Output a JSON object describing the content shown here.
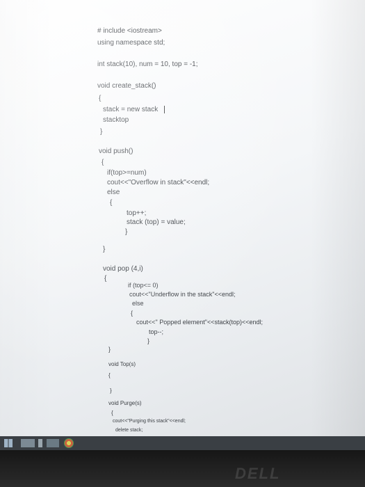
{
  "code": {
    "lines": [
      "# include <iostream>",
      "using namespace std;",
      "int stack(10), num = 10, top = -1;",
      "void create_stack()",
      "{",
      "stack = new stack",
      "stacktop",
      "}",
      "void push()",
      "{",
      "if(top>=num)",
      "cout<<\"Overflow in stack\"<<endl;",
      "else",
      "{",
      "top++;",
      "stack (top) = value;",
      "}",
      "}",
      "void pop (4,i)",
      "{",
      "if (top<= 0)",
      "cout<<\"Underflow in the stack\"<<endl;",
      "else",
      "{",
      "cout<<\" Popped element\"<<stack(top)<<endl;",
      "top--;",
      "}",
      "}",
      "void Top(s)",
      "{",
      "}",
      "void Purge(s)",
      "{",
      "cout<<\"Purging this stack\"<<endl;",
      "delete stack;"
    ]
  },
  "taskbar": {
    "icons": [
      "start-icon",
      "file-explorer-icon",
      "app-icon",
      "app-icon-2",
      "app-icon-3"
    ]
  },
  "colors": {
    "text": "#3b3f44",
    "taskbar": "#3a3f44",
    "screen": "#f4f6f8"
  }
}
